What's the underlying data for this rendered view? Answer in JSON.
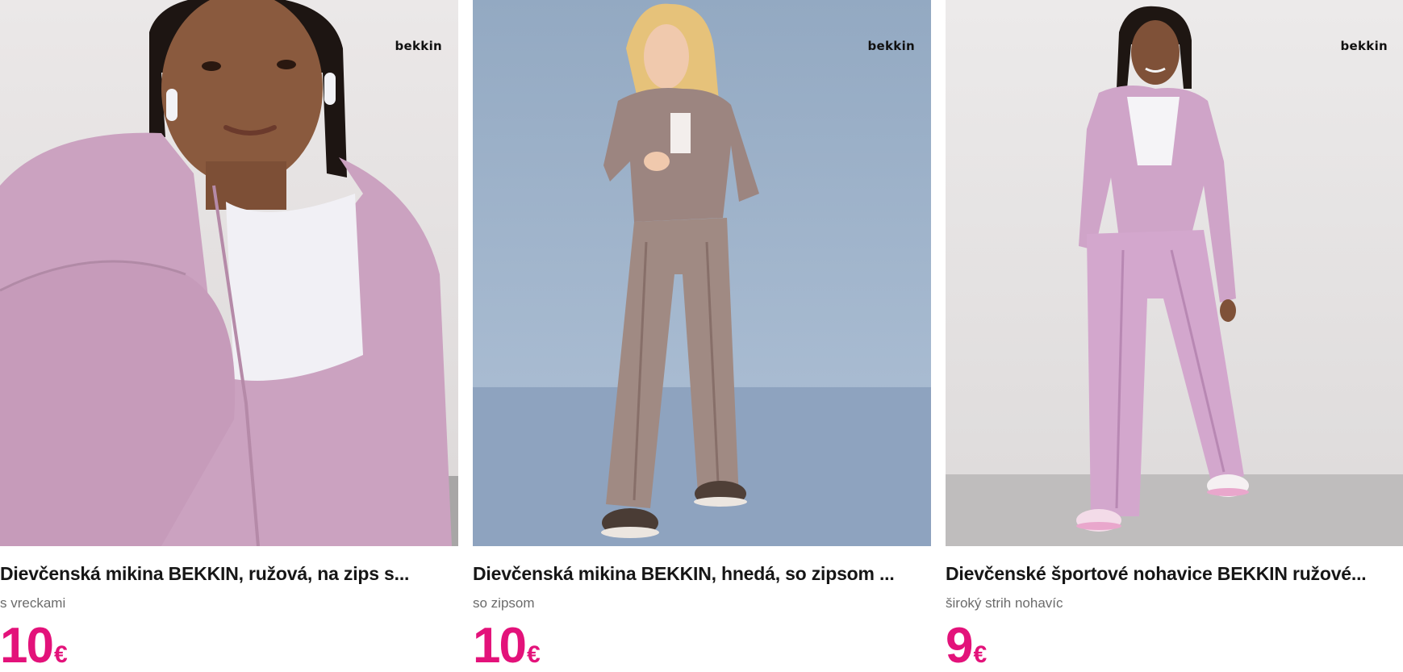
{
  "products": [
    {
      "brand": "bekkin",
      "title": "Dievčenská mikina BEKKIN, ružová, na zips s...",
      "subtitle": "s vreckami",
      "price": "10",
      "currency": "€"
    },
    {
      "brand": "bekkin",
      "title": "Dievčenská mikina BEKKIN, hnedá, so zipsom ...",
      "subtitle": "so zipsom",
      "price": "10",
      "currency": "€"
    },
    {
      "brand": "bekkin",
      "title": "Dievčenské športové nohavice BEKKIN ružové...",
      "subtitle": "široký strih nohavíc",
      "price": "9",
      "currency": "€"
    }
  ],
  "colors": {
    "price": "#e3127a",
    "pink_garment": "#cfa6c4",
    "brown_garment": "#9e8780",
    "blue_backdrop": "#9fb3c9",
    "grey_backdrop": "#e6e3e3"
  }
}
